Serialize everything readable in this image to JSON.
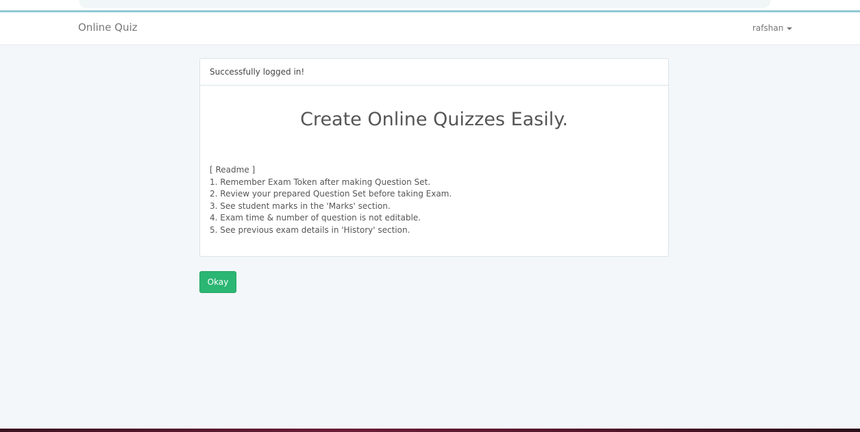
{
  "navbar": {
    "brand": "Online Quiz",
    "user": "rafshan"
  },
  "alert": {
    "message": "Successfully logged in!"
  },
  "main": {
    "title": "Create Online Quizzes Easily.",
    "readme_header": "[ Readme ]",
    "readme_items": [
      "1. Remember Exam Token after making Question Set.",
      "2. Review your prepared Question Set before taking Exam.",
      "3. See student marks in the 'Marks' section.",
      "4. Exam time & number of question is not editable.",
      "5. See previous exam details in 'History' section."
    ]
  },
  "actions": {
    "okay_label": "Okay"
  },
  "colors": {
    "button": "#2bb673",
    "background": "#f4f7fa",
    "panel_border": "#d6e4ea"
  }
}
